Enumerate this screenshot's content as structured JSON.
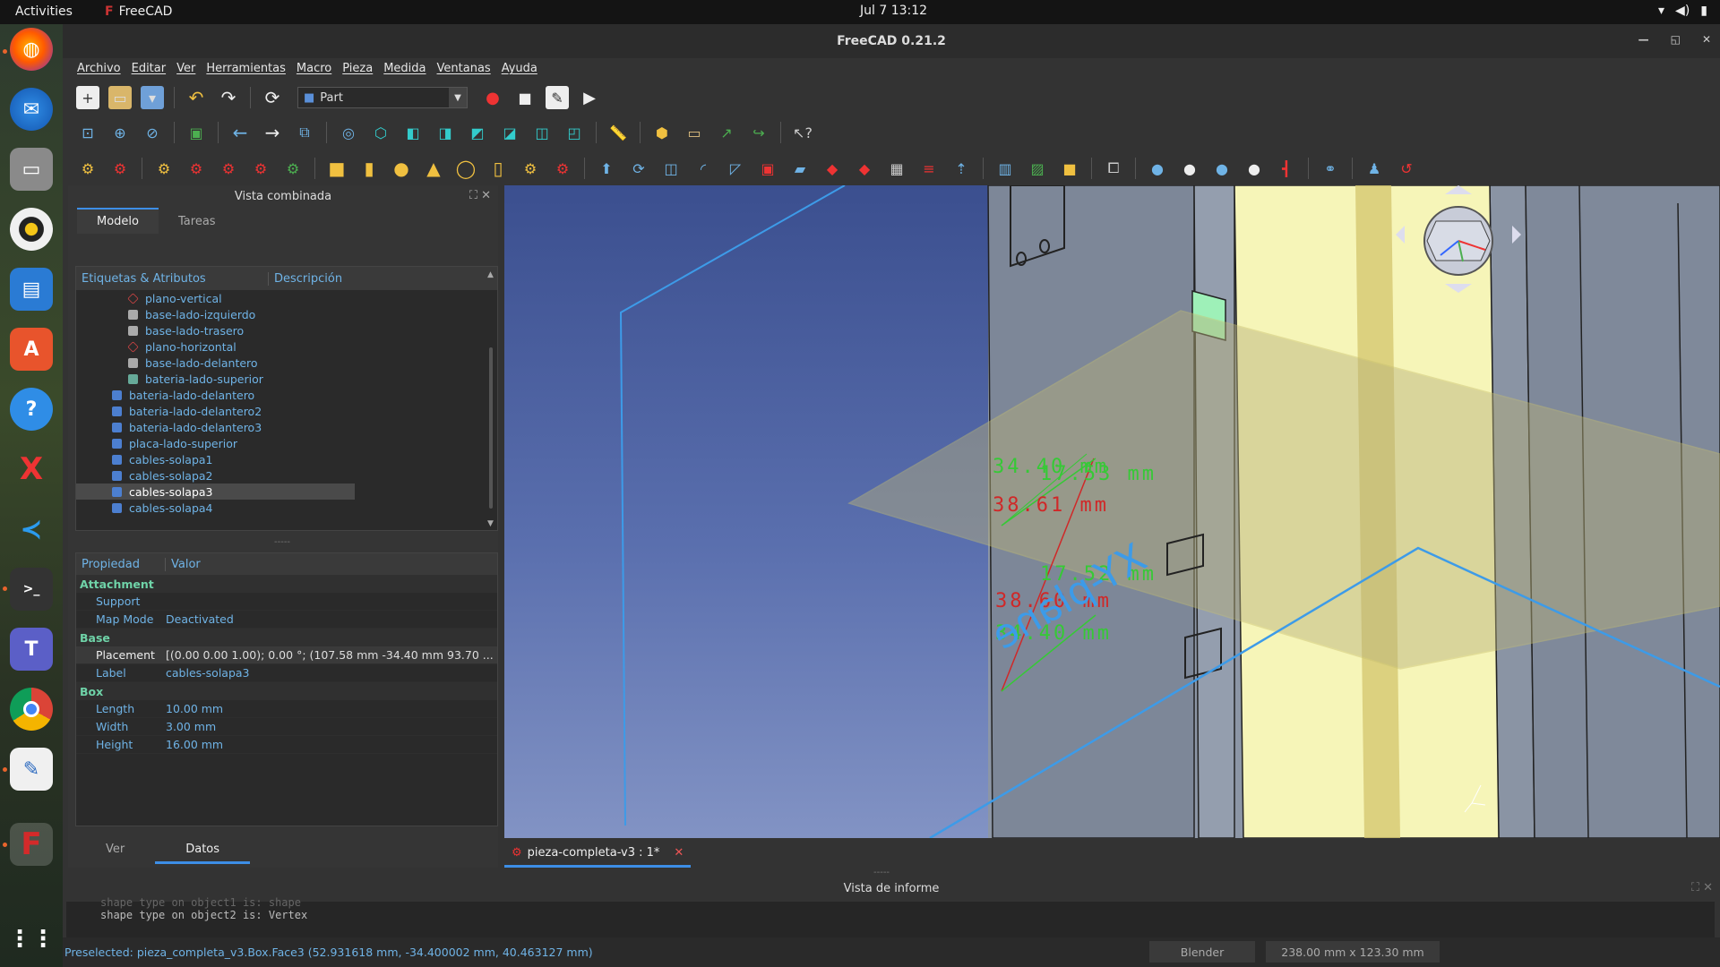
{
  "topbar": {
    "activities": "Activities",
    "app_name": "FreeCAD",
    "clock": "Jul 7  13:12"
  },
  "window": {
    "title": "FreeCAD 0.21.2"
  },
  "menu": [
    "Archivo",
    "Editar",
    "Ver",
    "Herramientas",
    "Macro",
    "Pieza",
    "Medida",
    "Ventanas",
    "Ayuda"
  ],
  "workbench": {
    "selected": "Part"
  },
  "combo": {
    "title": "Vista combinada",
    "tab_model": "Modelo",
    "tab_tasks": "Tareas",
    "tree_col_labels": "Etiquetas & Atributos",
    "tree_col_desc": "Descripción",
    "tree_items": [
      {
        "label": "plano-vertical",
        "indent": 2,
        "icon": "plane-icon"
      },
      {
        "label": "base-lado-izquierdo",
        "indent": 2,
        "icon": "solid-icon"
      },
      {
        "label": "base-lado-trasero",
        "indent": 2,
        "icon": "solid-icon"
      },
      {
        "label": "plano-horizontal",
        "indent": 2,
        "icon": "plane-icon"
      },
      {
        "label": "base-lado-delantero",
        "indent": 2,
        "icon": "solid-icon"
      },
      {
        "label": "bateria-lado-superior",
        "indent": 2,
        "icon": "body-icon"
      },
      {
        "label": "bateria-lado-delantero",
        "indent": 1,
        "icon": "box-icon"
      },
      {
        "label": "bateria-lado-delantero2",
        "indent": 1,
        "icon": "box-icon"
      },
      {
        "label": "bateria-lado-delantero3",
        "indent": 1,
        "icon": "box-icon"
      },
      {
        "label": "placa-lado-superior",
        "indent": 1,
        "icon": "box-icon"
      },
      {
        "label": "cables-solapa1",
        "indent": 1,
        "icon": "box-icon"
      },
      {
        "label": "cables-solapa2",
        "indent": 1,
        "icon": "box-icon"
      },
      {
        "label": "cables-solapa3",
        "indent": 1,
        "icon": "box-icon"
      },
      {
        "label": "cables-solapa4",
        "indent": 1,
        "icon": "box-icon"
      }
    ],
    "selected_item": "cables-solapa3",
    "prop_col_name": "Propiedad",
    "prop_col_value": "Valor",
    "groups": {
      "attachment": "Attachment",
      "base": "Base",
      "box": "Box"
    },
    "props": {
      "support_k": "Support",
      "support_v": "",
      "mapmode_k": "Map Mode",
      "mapmode_v": "Deactivated",
      "placement_k": "Placement",
      "placement_v": "[(0.00 0.00 1.00); 0.00 °; (107.58 mm  -34.40 mm  93.70 ...",
      "label_k": "Label",
      "label_v": "cables-solapa3",
      "length_k": "Length",
      "length_v": "10.00 mm",
      "width_k": "Width",
      "width_v": "3.00 mm",
      "height_k": "Height",
      "height_v": "16.00 mm"
    },
    "tab_view": "Ver",
    "tab_data": "Datos"
  },
  "viewport": {
    "dims": [
      "34.40 mm",
      "17.53 mm",
      "38.61 mm",
      "17.52 mm",
      "38.60 mm",
      "34.40 mm"
    ],
    "plane_label": "XY-plane"
  },
  "doc_tab": {
    "label": "pieza-completa-v3 : 1*"
  },
  "report": {
    "title": "Vista de informe",
    "lines": [
      "shape type on object1 is: shape",
      "shape type on object2 is: Vertex"
    ]
  },
  "status": {
    "text": "Preselected: pieza_completa_v3.Box.Face3 (52.931618 mm, -34.400002 mm, 40.463127 mm)",
    "nav_style": "Blender",
    "dims": "238.00 mm x 123.30 mm"
  },
  "colors": {
    "accent": "#3d8ee6",
    "tree_text": "#6fb3e6",
    "group_text": "#6fd3a8",
    "dim_green": "#36c936",
    "dim_red": "#d02828"
  }
}
